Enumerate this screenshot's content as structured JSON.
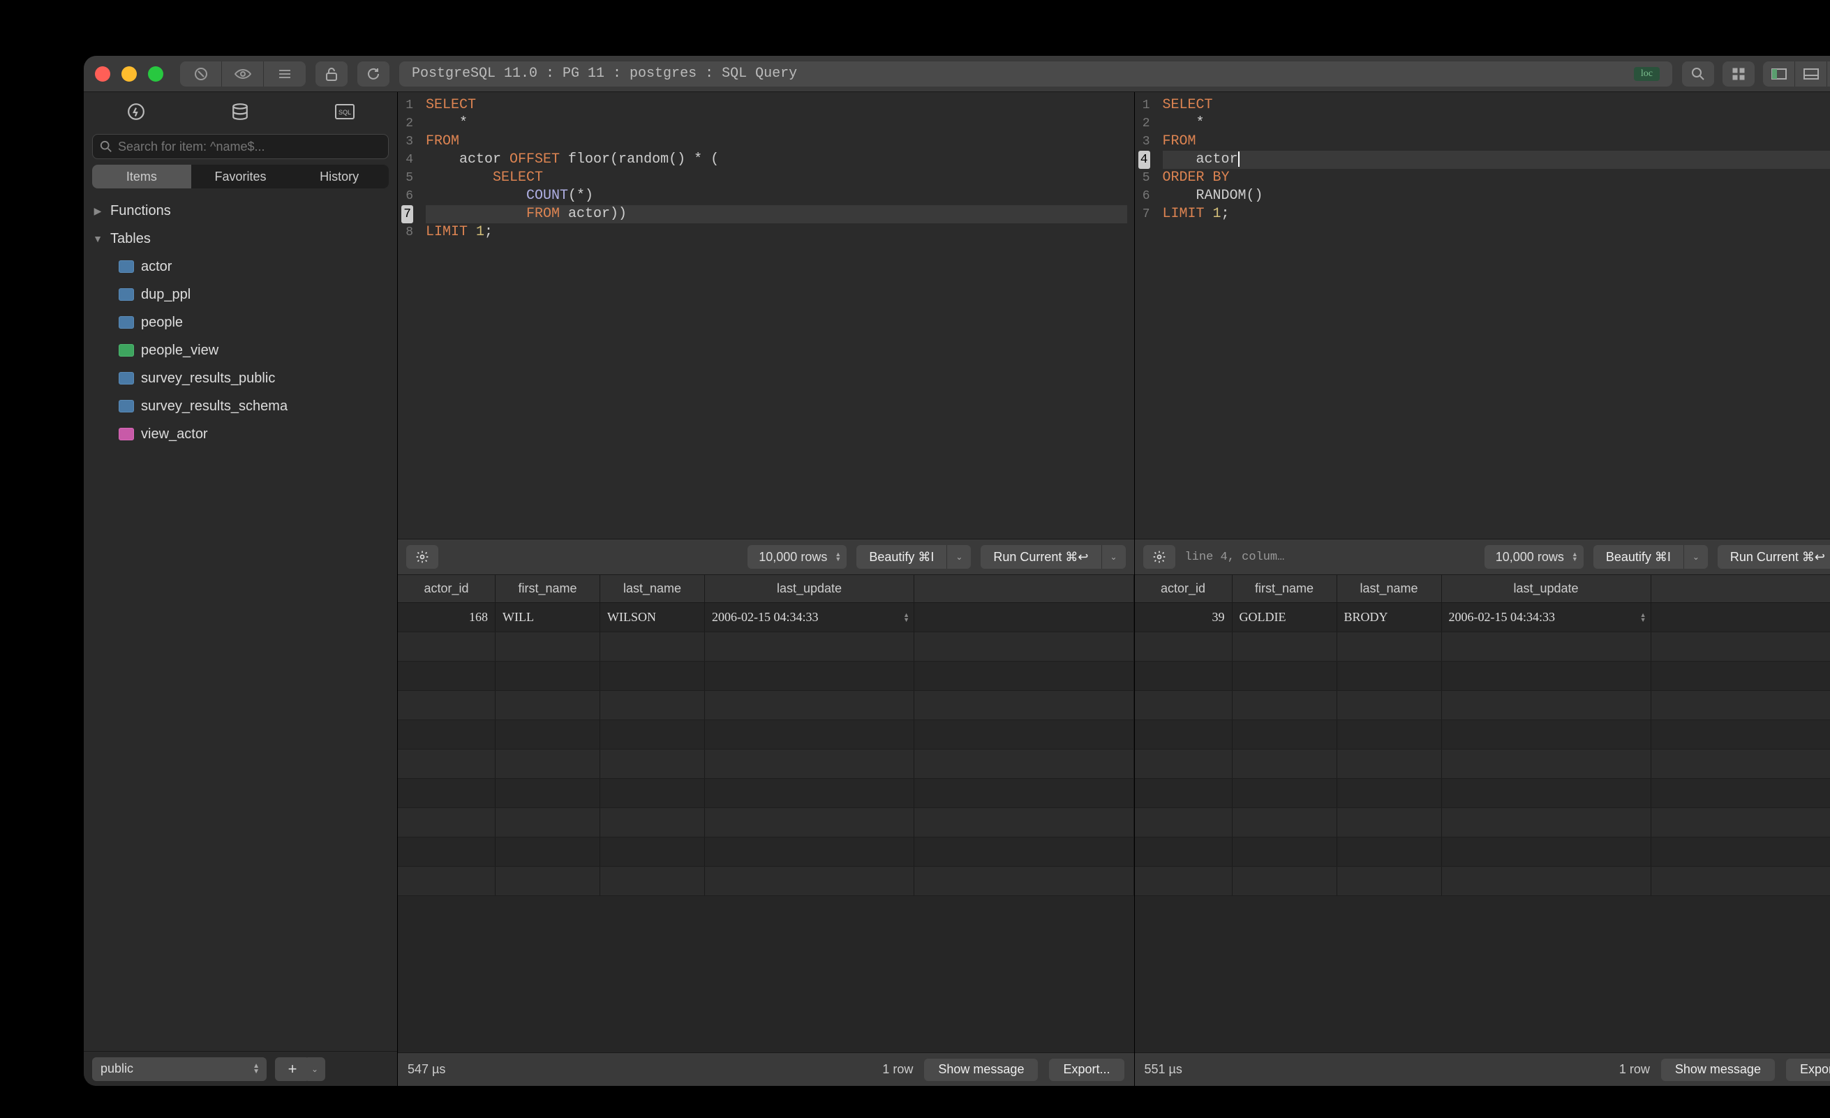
{
  "title": "PostgreSQL 11.0 : PG 11 : postgres : SQL Query",
  "loc_badge": "loc",
  "sidebar": {
    "search_placeholder": "Search for item: ^name$...",
    "segments": [
      "Items",
      "Favorites",
      "History"
    ],
    "tree": {
      "functions_label": "Functions",
      "tables_label": "Tables",
      "tables": [
        {
          "name": "actor",
          "kind": "table"
        },
        {
          "name": "dup_ppl",
          "kind": "table"
        },
        {
          "name": "people",
          "kind": "table"
        },
        {
          "name": "people_view",
          "kind": "mat"
        },
        {
          "name": "survey_results_public",
          "kind": "table"
        },
        {
          "name": "survey_results_schema",
          "kind": "table"
        },
        {
          "name": "view_actor",
          "kind": "view"
        }
      ]
    },
    "schema": "public"
  },
  "left": {
    "gutter_hl": 7,
    "code_lines": [
      [
        {
          "t": "SELECT",
          "c": "kw"
        }
      ],
      [
        {
          "t": "    *",
          "c": "id"
        }
      ],
      [
        {
          "t": "FROM",
          "c": "kw"
        }
      ],
      [
        {
          "t": "    actor ",
          "c": "id"
        },
        {
          "t": "OFFSET",
          "c": "kw"
        },
        {
          "t": " floor(random() * (",
          "c": "id"
        }
      ],
      [
        {
          "t": "        ",
          "c": "id"
        },
        {
          "t": "SELECT",
          "c": "kw"
        }
      ],
      [
        {
          "t": "            ",
          "c": "id"
        },
        {
          "t": "COUNT",
          "c": "fn"
        },
        {
          "t": "(*)",
          "c": "id"
        }
      ],
      [
        {
          "t": "            ",
          "c": "id"
        },
        {
          "t": "FROM",
          "c": "kw"
        },
        {
          "t": " actor))",
          "c": "id"
        }
      ],
      [
        {
          "t": "LIMIT",
          "c": "kw"
        },
        {
          "t": " ",
          "c": "id"
        },
        {
          "t": "1",
          "c": "num"
        },
        {
          "t": ";",
          "c": "id"
        }
      ]
    ],
    "rows_label": "10,000 rows",
    "beautify_label": "Beautify ⌘I",
    "run_label": "Run Current ⌘↩",
    "columns": [
      "actor_id",
      "first_name",
      "last_name",
      "last_update"
    ],
    "data": [
      {
        "actor_id": "168",
        "first_name": "WILL",
        "last_name": "WILSON",
        "last_update": "2006-02-15 04:34:33"
      }
    ],
    "elapsed": "547 µs",
    "row_count": "1 row",
    "show_msg": "Show message",
    "export": "Export..."
  },
  "right": {
    "gutter_hl": 4,
    "status": "line 4, colum…",
    "code_lines": [
      [
        {
          "t": "SELECT",
          "c": "kw"
        }
      ],
      [
        {
          "t": "    *",
          "c": "id"
        }
      ],
      [
        {
          "t": "FROM",
          "c": "kw"
        }
      ],
      [
        {
          "t": "    actor",
          "c": "id"
        }
      ],
      [
        {
          "t": "ORDER BY",
          "c": "kw"
        }
      ],
      [
        {
          "t": "    RANDOM()",
          "c": "id"
        }
      ],
      [
        {
          "t": "LIMIT",
          "c": "kw"
        },
        {
          "t": " ",
          "c": "id"
        },
        {
          "t": "1",
          "c": "num"
        },
        {
          "t": ";",
          "c": "id"
        }
      ]
    ],
    "rows_label": "10,000 rows",
    "beautify_label": "Beautify ⌘I",
    "run_label": "Run Current ⌘↩",
    "columns": [
      "actor_id",
      "first_name",
      "last_name",
      "last_update"
    ],
    "data": [
      {
        "actor_id": "39",
        "first_name": "GOLDIE",
        "last_name": "BRODY",
        "last_update": "2006-02-15 04:34:33"
      }
    ],
    "elapsed": "551 µs",
    "row_count": "1 row",
    "show_msg": "Show message",
    "export": "Export..."
  }
}
